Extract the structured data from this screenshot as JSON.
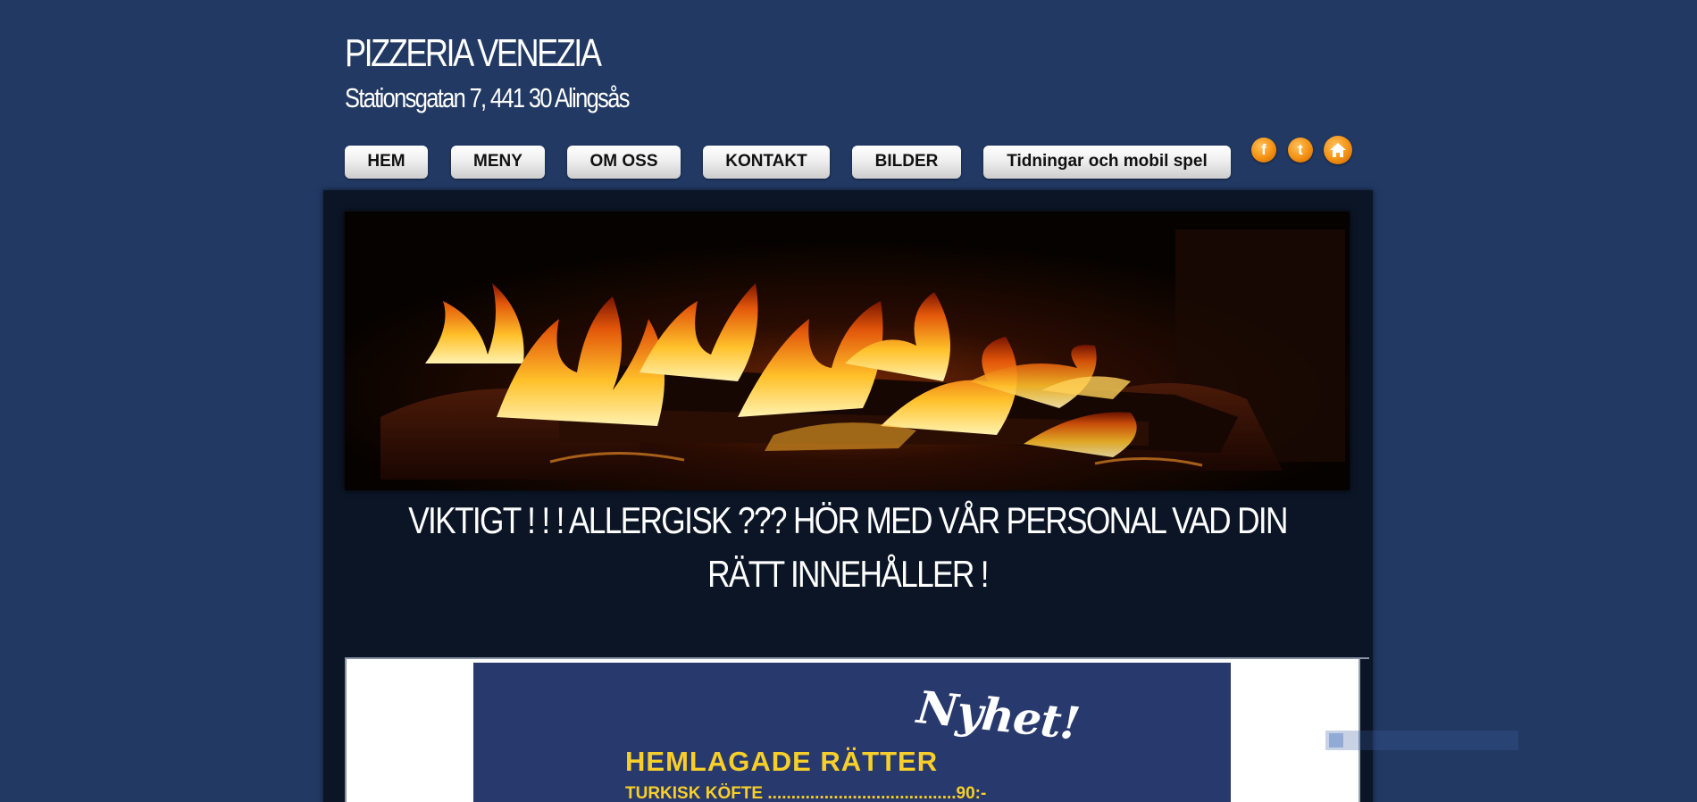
{
  "header": {
    "title": "PIZZERIA VENEZIA",
    "address": "Stationsgatan 7, 441 30 Alingsås"
  },
  "nav": {
    "items": [
      {
        "label": "HEM"
      },
      {
        "label": "MENY"
      },
      {
        "label": "OM OSS"
      },
      {
        "label": "KONTAKT"
      },
      {
        "label": "BILDER"
      },
      {
        "label": "Tidningar och mobil spel"
      }
    ]
  },
  "social": {
    "icons": [
      {
        "name": "facebook-icon",
        "glyph": "f"
      },
      {
        "name": "twitter-icon",
        "glyph": "t"
      },
      {
        "name": "home-icon",
        "glyph": ""
      }
    ],
    "accent_color": "#f39012"
  },
  "main": {
    "notice": "VIKTIGT ! ! ! ALLERGISK ??? HÖR MED VÅR PERSONAL VAD DIN RÄTT INNEHÅLLER !"
  },
  "promo": {
    "badge": "Nyhet!",
    "heading": "HEMLAGADE RÄTTER",
    "first_item": "TURKISK KÖFTE ........................................90:-"
  },
  "colors": {
    "background": "#213963",
    "panel": "#0b1526",
    "promo_background": "#283a6d",
    "promo_text": "#f8cf2a"
  }
}
